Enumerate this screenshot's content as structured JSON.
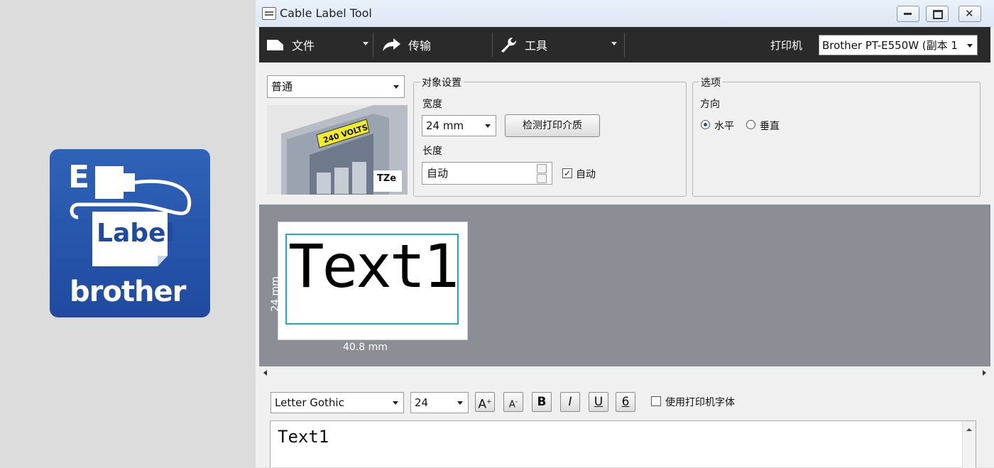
{
  "app_icon": {
    "letter": "E",
    "label": "Label",
    "brand": "brother"
  },
  "window": {
    "title": "Cable Label Tool"
  },
  "toolbar": {
    "file_label": "文件",
    "transfer_label": "传输",
    "tools_label": "工具",
    "printer_label": "打印机",
    "printer_value": "Brother PT-E550W (副本 1"
  },
  "settings": {
    "preset_value": "普通",
    "tape_image_text": "240 VOLTS",
    "tape_brand": "TZe",
    "object_group_title": "对象设置",
    "width_label": "宽度",
    "width_value": "24 mm",
    "detect_button": "检测打印介质",
    "length_label": "长度",
    "length_value": "自动",
    "auto_checkbox_label": "自动",
    "options_group_title": "选项",
    "direction_label": "方向",
    "horizontal_label": "水平",
    "vertical_label": "垂直"
  },
  "canvas": {
    "label_text": "Text1",
    "width_dimension": "40.8 mm",
    "height_dimension": "24 mm",
    "frame_color": "#21a7d9"
  },
  "font_toolbar": {
    "font_value": "Letter Gothic",
    "size_value": "24",
    "grow_label": "A",
    "shrink_label": "A",
    "bold_label": "B",
    "italic_label": "I",
    "underline_label": "U",
    "frame_label": "6",
    "printer_font_label": "使用打印机字体"
  },
  "editor": {
    "text": "Text1"
  }
}
